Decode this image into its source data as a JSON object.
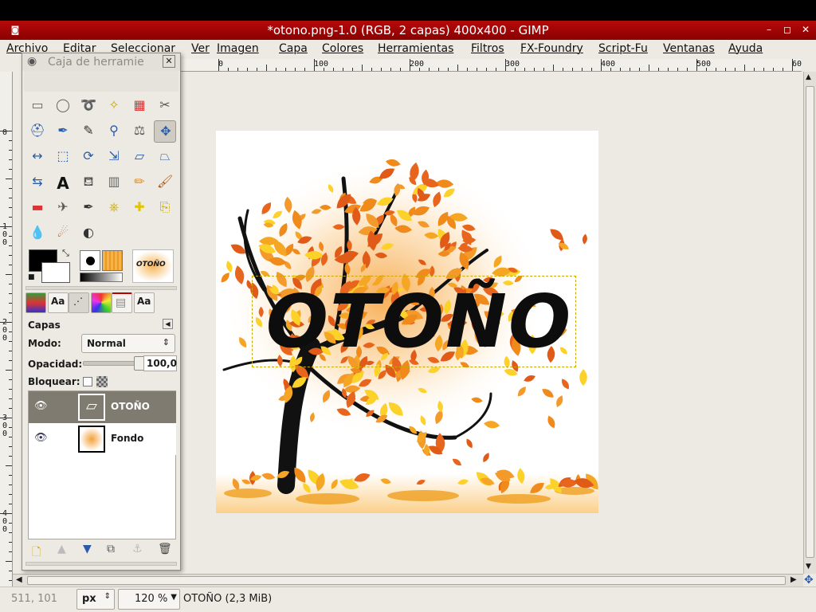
{
  "window": {
    "title": "*otono.png-1.0 (RGB, 2 capas) 400x400 - GIMP"
  },
  "menu": {
    "items": [
      "Archivo",
      "Editar",
      "Seleccionar",
      "Ver",
      "Imagen",
      "Capa",
      "Colores",
      "Herramientas",
      "Filtros",
      "FX-Foundry",
      "Script-Fu",
      "Ventanas",
      "Ayuda"
    ]
  },
  "rulers": {
    "h_labels": [
      "0",
      "100",
      "200",
      "300",
      "400",
      "500",
      "60"
    ],
    "v_labels": [
      "0",
      "1\n0\n0",
      "2\n0\n0",
      "3\n0\n0",
      "4\n0\n0"
    ]
  },
  "canvas": {
    "text": "OTOÑO"
  },
  "status": {
    "coords": "511, 101",
    "unit": "px",
    "zoom": "120 %",
    "info": "OTOÑO (2,3 MiB)"
  },
  "toolbox": {
    "title": "Caja de herramie",
    "brush_preview_text": "OTOÑO",
    "panel_title": "Capas",
    "mode_label": "Modo:",
    "mode_value": "Normal",
    "opacity_label": "Opacidad:",
    "opacity_value": "100,0",
    "opacity_fraction": 1.0,
    "lock_label": "Bloquear:",
    "layers": [
      {
        "name": "OTOÑO",
        "visible": true,
        "selected": true
      },
      {
        "name": "Fondo",
        "visible": true,
        "selected": false
      }
    ]
  },
  "colors": {
    "titlebar": "#a00000",
    "accent": "#e87d1e",
    "selected_layer": "#7f7b71"
  }
}
